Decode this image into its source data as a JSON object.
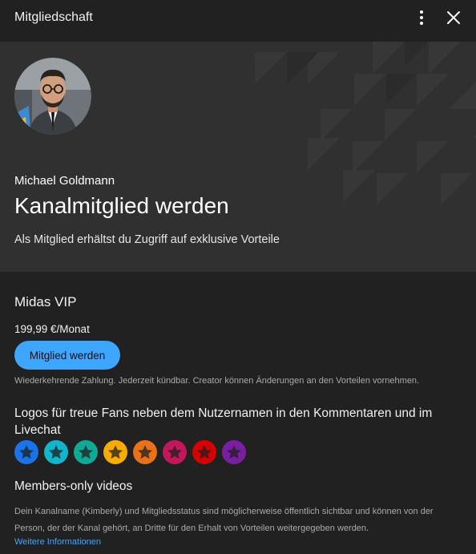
{
  "header": {
    "title": "Mitgliedschaft",
    "more_icon": "vertical-dots-icon",
    "close_icon": "close-icon"
  },
  "hero": {
    "creator_name": "Michael Goldmann",
    "title": "Kanalmitglied werden",
    "subtitle": "Als Mitglied erhältst du Zugriff auf exklusive Vorteile"
  },
  "tier": {
    "name": "Midas VIP",
    "price": "199,99 €/Monat",
    "join_label": "Mitglied werden",
    "disclaimer": "Wiederkehrende Zahlung. Jederzeit kündbar. Creator können Änderungen an den Vorteilen vornehmen."
  },
  "perks": {
    "badges_heading": "Logos für treue Fans neben dem Nutzernamen in den Kommentaren und im Livechat",
    "badges": [
      {
        "icon": "star-icon",
        "color": "#1a73e8"
      },
      {
        "icon": "star-icon",
        "color": "#12b5cb"
      },
      {
        "icon": "star-icon",
        "color": "#0fa995"
      },
      {
        "icon": "star-icon",
        "color": "#f9ab00"
      },
      {
        "icon": "star-icon",
        "color": "#e8711a"
      },
      {
        "icon": "star-icon",
        "color": "#c2185b"
      },
      {
        "icon": "star-icon",
        "color": "#d50000"
      },
      {
        "icon": "star-icon",
        "color": "#7b1fa2"
      }
    ],
    "members_videos": "Members-only videos"
  },
  "footer": {
    "privacy_text": "Dein Kanalname (Kimberly) und Mitgliedsstatus sind möglicherweise öffentlich sichtbar und können von der Person, der der Kanal gehört, an Dritte für den Erhalt von Vorteilen weitergegeben werden.",
    "more_info_link": "Weitere Informationen"
  },
  "colors": {
    "accent": "#3ea6ff",
    "background": "#212121",
    "hero_background": "#303030"
  }
}
